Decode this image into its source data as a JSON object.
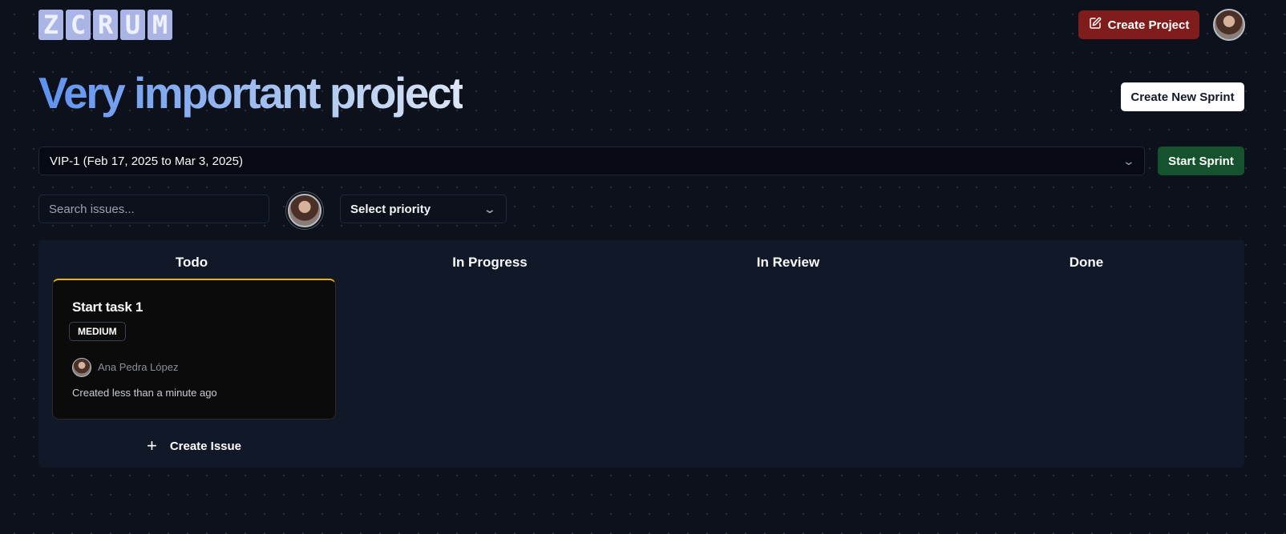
{
  "brand": {
    "logo_letters": [
      "Z",
      "C",
      "R",
      "U",
      "M"
    ]
  },
  "header": {
    "create_project_label": "Create Project",
    "user_avatar": "user-avatar"
  },
  "project": {
    "title": "Very important project",
    "create_sprint_label": "Create New Sprint"
  },
  "sprint": {
    "selected": "VIP-1 (Feb 17, 2025 to Mar 3, 2025)",
    "start_label": "Start Sprint"
  },
  "filters": {
    "search_placeholder": "Search issues...",
    "priority_placeholder": "Select priority"
  },
  "board": {
    "columns": [
      "Todo",
      "In Progress",
      "In Review",
      "Done"
    ],
    "create_issue_label": "Create Issue",
    "issues": [
      {
        "title": "Start task 1",
        "priority": "MEDIUM",
        "priority_color": "#eab308",
        "assignee": "Ana Pedra López",
        "created": "Created less than a minute ago"
      }
    ]
  },
  "icons": {
    "edit": "edit-icon",
    "chevron": "chevron-down-icon",
    "plus": "plus-icon"
  },
  "colors": {
    "background": "#0d111c",
    "create_project": "#7f1d1d",
    "start_sprint": "#14532d",
    "board": "#111828"
  }
}
